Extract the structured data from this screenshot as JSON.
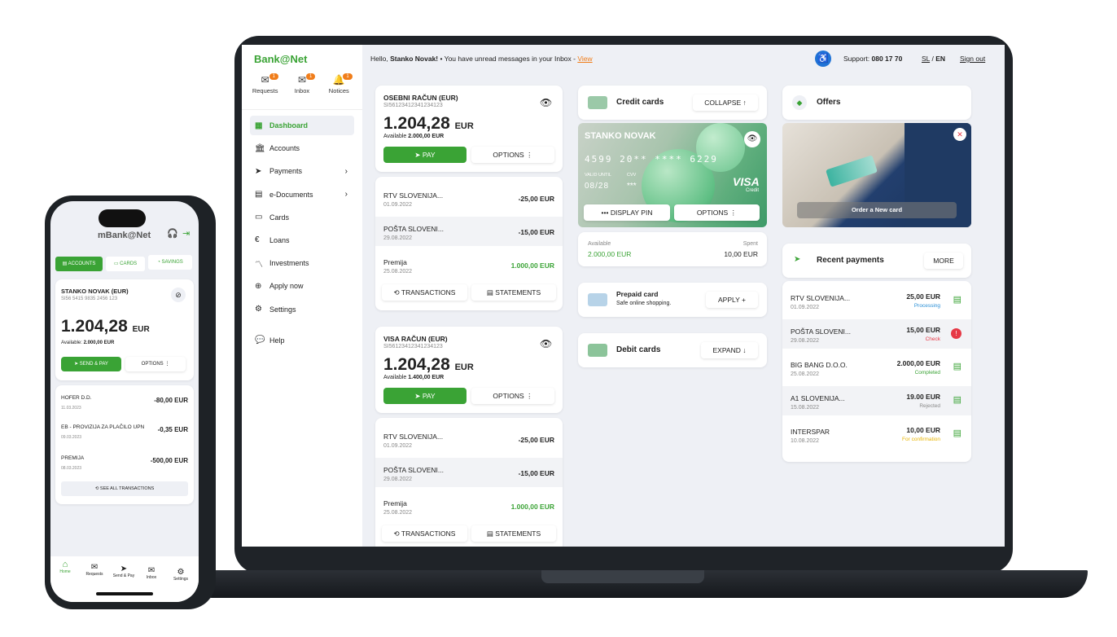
{
  "desktop": {
    "logo": "Bank@Net",
    "top_icons": [
      {
        "label": "Requests",
        "badge": "1"
      },
      {
        "label": "Inbox",
        "badge": "1"
      },
      {
        "label": "Notices",
        "badge": "1"
      }
    ],
    "nav": [
      "Dashboard",
      "Accounts",
      "Payments",
      "e-Documents",
      "Cards",
      "Loans",
      "Investments",
      "Apply now",
      "Settings"
    ],
    "help": "Help",
    "greeting_prefix": "Hello, ",
    "greeting_name": "Stanko Novak!",
    "greeting_rest": " • You have unread messages in your Inbox - ",
    "view_link": "View",
    "support_label": "Support:",
    "support_number": "080 17 70",
    "lang_sl": "SL",
    "lang_sep": "/",
    "lang_en": "EN",
    "signout": "Sign out",
    "account1": {
      "name": "OSEBNI RAČUN (EUR)",
      "iban": "SI56123412341234123",
      "balance": "1.204,28",
      "currency": "EUR",
      "available_label": "Available",
      "available": "2.000,00 EUR",
      "pay": "PAY",
      "options": "OPTIONS",
      "tx": [
        {
          "name": "RTV SLOVENIJA...",
          "date": "01.09.2022",
          "amount": "-25,00 EUR"
        },
        {
          "name": "POŠTA SLOVENI...",
          "date": "29.08.2022",
          "amount": "-15,00 EUR"
        },
        {
          "name": "Premija",
          "date": "25.08.2022",
          "amount": "1.000,00 EUR"
        }
      ],
      "transactions": "TRANSACTIONS",
      "statements": "STATEMENTS"
    },
    "account2": {
      "name": "VISA RAČUN (EUR)",
      "iban": "SI56123412341234123",
      "balance": "1.204,28",
      "currency": "EUR",
      "available_label": "Available",
      "available": "1.400,00 EUR",
      "pay": "PAY",
      "options": "OPTIONS",
      "tx": [
        {
          "name": "RTV SLOVENIJA...",
          "date": "01.09.2022",
          "amount": "-25,00 EUR"
        },
        {
          "name": "POŠTA SLOVENI...",
          "date": "29.08.2022",
          "amount": "-15,00 EUR"
        },
        {
          "name": "Premija",
          "date": "25.08.2022",
          "amount": "1.000,00 EUR"
        }
      ],
      "transactions": "TRANSACTIONS",
      "statements": "STATEMENTS"
    },
    "credit": {
      "title": "Credit cards",
      "collapse": "COLLAPSE",
      "holder": "STANKO NOVAK",
      "number": "4599 20** **** 6229",
      "valid_label": "VALID UNTIL",
      "cvv_label": "CVV",
      "valid": "08/28",
      "cvv": "***",
      "brand": "VISA",
      "brand_sub": "Credit",
      "display_pin": "DISPLAY PIN",
      "options": "OPTIONS",
      "available_label": "Available",
      "available": "2.000,00 EUR",
      "spent_label": "Spent",
      "spent": "10,00 EUR"
    },
    "prepaid": {
      "title": "Prepaid card",
      "subtitle": "Safe online shopping.",
      "apply": "APPLY"
    },
    "debit": {
      "title": "Debit cards",
      "expand": "EXPAND"
    },
    "offers": {
      "title": "Offers",
      "cta": "Order a New card"
    },
    "recent": {
      "title": "Recent payments",
      "more": "MORE",
      "items": [
        {
          "name": "RTV SLOVENIJA...",
          "date": "01.09.2022",
          "amount": "25,00 EUR",
          "status": "Processing",
          "color": "#2a8fd6"
        },
        {
          "name": "POŠTA SLOVENI...",
          "date": "29.08.2022",
          "amount": "15,00 EUR",
          "status": "Check",
          "color": "#e63946"
        },
        {
          "name": "BIG BANG D.O.O.",
          "date": "25.08.2022",
          "amount": "2.000,00 EUR",
          "status": "Completed",
          "color": "#3aa335"
        },
        {
          "name": "A1 SLOVENIJA...",
          "date": "15.08.2022",
          "amount": "19.00 EUR",
          "status": "Rejected",
          "color": "#888888"
        },
        {
          "name": "INTERSPAR",
          "date": "10.08.2022",
          "amount": "10,00 EUR",
          "status": "For confirmation",
          "color": "#e8b400"
        }
      ]
    }
  },
  "mobile": {
    "logo": "mBank@Net",
    "tabs": [
      "ACCOUNTS",
      "CARDS",
      "SAVINGS"
    ],
    "account": {
      "name": "STANKO NOVAK (EUR)",
      "iban": "SI56 5415 9835 2456 123",
      "balance": "1.204,28",
      "currency": "EUR",
      "available_label": "Available:",
      "available": "2.000,00 EUR",
      "send": "SEND & PAY",
      "options": "OPTIONS"
    },
    "tx": [
      {
        "name": "HOFER D.D.",
        "date": "11.03.2023",
        "amount": "-80,00 EUR"
      },
      {
        "name": "EB - PROVIZIJA ZA PLAČILO UPN",
        "date": "09.03.2023",
        "amount": "-0,35 EUR"
      },
      {
        "name": "PREMIJA",
        "date": "08.03.2023",
        "amount": "-500,00 EUR"
      }
    ],
    "see_all": "SEE ALL TRANSACTIONS",
    "bottom": [
      "Home",
      "Requests",
      "Send & Pay",
      "Inbox",
      "Settings"
    ]
  }
}
